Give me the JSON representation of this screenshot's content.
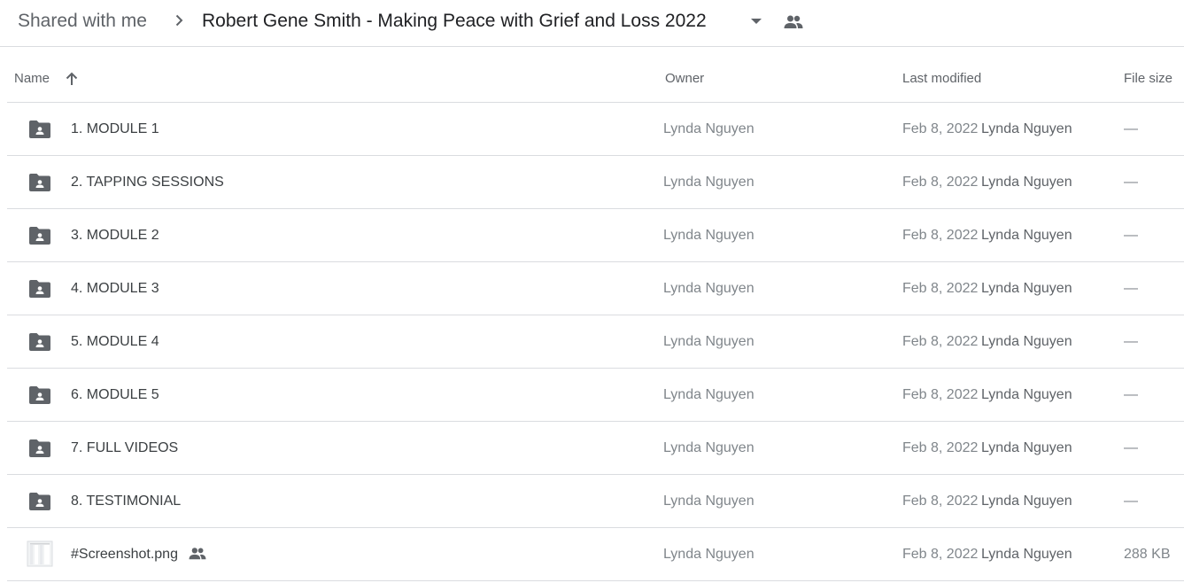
{
  "breadcrumb": {
    "root": "Shared with me",
    "current": "Robert Gene Smith - Making Peace with Grief and Loss 2022",
    "icons": [
      "chevron-right-icon",
      "caret-down-icon",
      "shared-people-icon"
    ]
  },
  "columns": {
    "name": "Name",
    "owner": "Owner",
    "last_modified": "Last modified",
    "file_size": "File size",
    "sort_icon": "arrow-up-icon"
  },
  "files": [
    {
      "name": "1. MODULE 1",
      "type": "shared-folder",
      "owner": "Lynda Nguyen",
      "date": "Feb 8, 2022",
      "modifier": "Lynda Nguyen",
      "size": "—"
    },
    {
      "name": "2. TAPPING SESSIONS",
      "type": "shared-folder",
      "owner": "Lynda Nguyen",
      "date": "Feb 8, 2022",
      "modifier": "Lynda Nguyen",
      "size": "—"
    },
    {
      "name": "3. MODULE 2",
      "type": "shared-folder",
      "owner": "Lynda Nguyen",
      "date": "Feb 8, 2022",
      "modifier": "Lynda Nguyen",
      "size": "—"
    },
    {
      "name": "4. MODULE 3",
      "type": "shared-folder",
      "owner": "Lynda Nguyen",
      "date": "Feb 8, 2022",
      "modifier": "Lynda Nguyen",
      "size": "—"
    },
    {
      "name": "5. MODULE 4",
      "type": "shared-folder",
      "owner": "Lynda Nguyen",
      "date": "Feb 8, 2022",
      "modifier": "Lynda Nguyen",
      "size": "—"
    },
    {
      "name": "6. MODULE 5",
      "type": "shared-folder",
      "owner": "Lynda Nguyen",
      "date": "Feb 8, 2022",
      "modifier": "Lynda Nguyen",
      "size": "—"
    },
    {
      "name": "7. FULL VIDEOS",
      "type": "shared-folder",
      "owner": "Lynda Nguyen",
      "date": "Feb 8, 2022",
      "modifier": "Lynda Nguyen",
      "size": "—"
    },
    {
      "name": "8. TESTIMONIAL",
      "type": "shared-folder",
      "owner": "Lynda Nguyen",
      "date": "Feb 8, 2022",
      "modifier": "Lynda Nguyen",
      "size": "—"
    },
    {
      "name": "#Screenshot.png",
      "type": "image-file",
      "shared": true,
      "owner": "Lynda Nguyen",
      "date": "Feb 8, 2022",
      "modifier": "Lynda Nguyen",
      "size": "288 KB"
    }
  ],
  "colors": {
    "text_primary": "#3c4043",
    "text_secondary": "#80868b",
    "divider": "#dadce0",
    "icon": "#5f6368"
  }
}
